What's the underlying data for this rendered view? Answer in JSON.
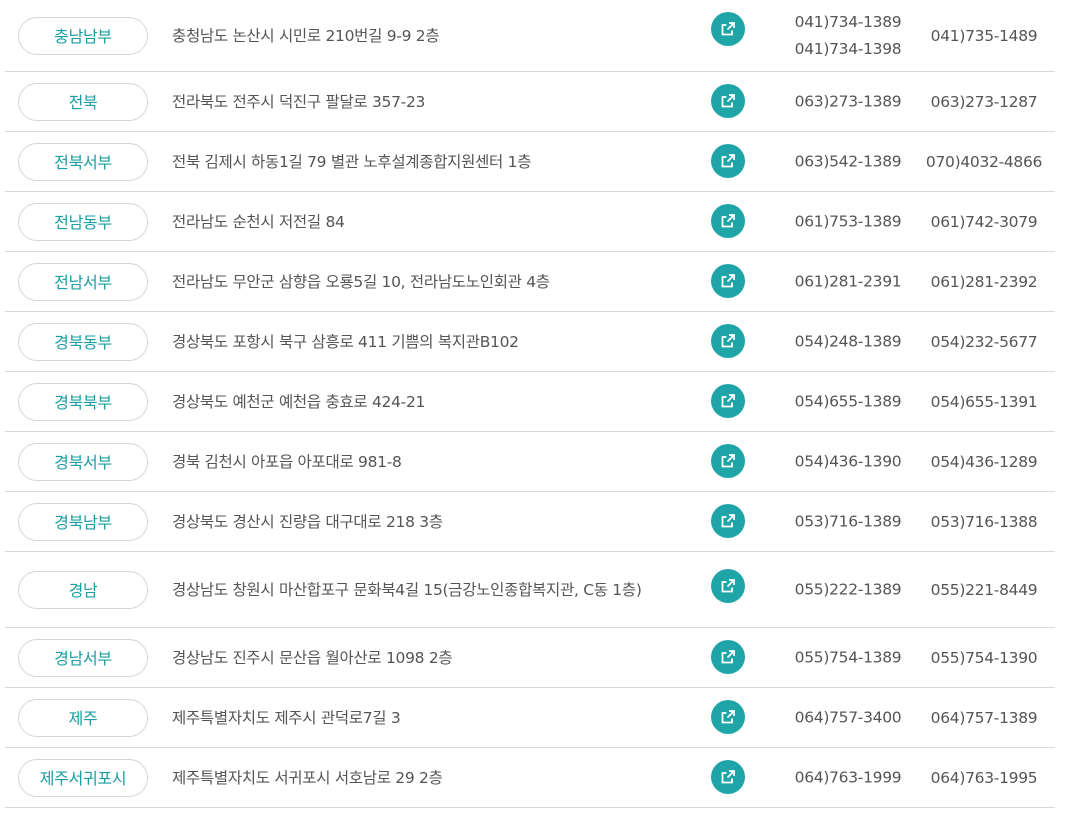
{
  "rows": [
    {
      "region": "충남남부",
      "address": "충청남도 논산시 시민로 210번길 9-9 2층",
      "phones": [
        "041)734-1389",
        "041)734-1398"
      ],
      "fax": "041)735-1489"
    },
    {
      "region": "전북",
      "address": "전라북도 전주시 덕진구 팔달로 357-23",
      "phones": [
        "063)273-1389"
      ],
      "fax": "063)273-1287"
    },
    {
      "region": "전북서부",
      "address": "전북 김제시 하동1길 79 별관 노후설계종합지원센터 1층",
      "phones": [
        "063)542-1389"
      ],
      "fax": "070)4032-4866"
    },
    {
      "region": "전남동부",
      "address": "전라남도 순천시 저전길 84",
      "phones": [
        "061)753-1389"
      ],
      "fax": "061)742-3079"
    },
    {
      "region": "전남서부",
      "address": "전라남도 무안군 삼향읍 오룡5길 10, 전라남도노인회관 4층",
      "phones": [
        "061)281-2391"
      ],
      "fax": "061)281-2392"
    },
    {
      "region": "경북동부",
      "address": "경상북도 포항시 북구 삼흥로 411 기쁨의 복지관B102",
      "phones": [
        "054)248-1389"
      ],
      "fax": "054)232-5677"
    },
    {
      "region": "경북북부",
      "address": "경상북도 예천군 예천읍 충효로 424-21",
      "phones": [
        "054)655-1389"
      ],
      "fax": "054)655-1391"
    },
    {
      "region": "경북서부",
      "address": "경북 김천시 아포읍 아포대로 981-8",
      "phones": [
        "054)436-1390"
      ],
      "fax": "054)436-1289"
    },
    {
      "region": "경북남부",
      "address": "경상북도 경산시 진량읍 대구대로 218 3층",
      "phones": [
        "053)716-1389"
      ],
      "fax": "053)716-1388"
    },
    {
      "region": "경남",
      "address": "경상남도 창원시 마산합포구 문화북4길 15(금강노인종합복지관, C동 1층)",
      "phones": [
        "055)222-1389"
      ],
      "fax": "055)221-8449"
    },
    {
      "region": "경남서부",
      "address": "경상남도 진주시 문산읍 월아산로 1098 2층",
      "phones": [
        "055)754-1389"
      ],
      "fax": "055)754-1390"
    },
    {
      "region": "제주",
      "address": "제주특별자치도 제주시 관덕로7길 3",
      "phones": [
        "064)757-3400"
      ],
      "fax": "064)757-1389"
    },
    {
      "region": "제주서귀포시",
      "address": "제주특별자치도 서귀포시 서호남로 29 2층",
      "phones": [
        "064)763-1999"
      ],
      "fax": "064)763-1995"
    }
  ],
  "icons": {
    "link": "external-link-icon"
  },
  "colors": {
    "accent": "#1fa5a8",
    "region_text": "#1a9ea2",
    "border": "#d9d9d9",
    "text": "#555555"
  }
}
